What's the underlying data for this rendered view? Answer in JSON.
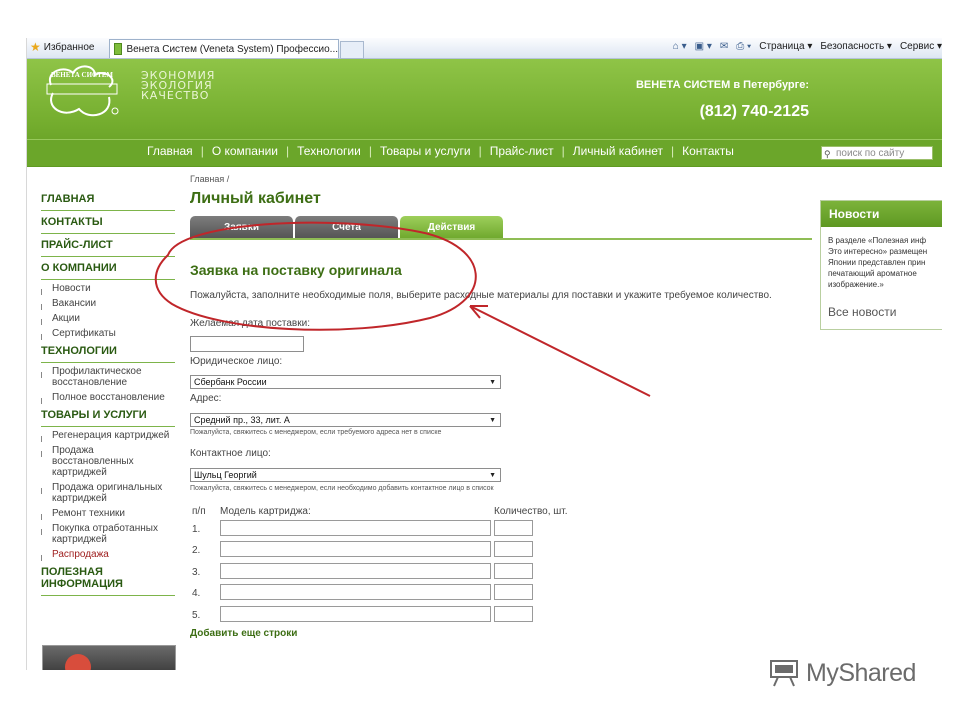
{
  "browser": {
    "favorites_label": "Избранное",
    "tab_title": "Венета Систем (Veneta System) Профессио...",
    "tools": [
      "Страница ▾",
      "Безопасность ▾",
      "Сервис ▾"
    ]
  },
  "header": {
    "logo_text": "ВЕНЕТА СИСТЕМ",
    "slogan": [
      "Экономия",
      "Экология",
      "Качество"
    ],
    "contact_city": "ВЕНЕТА СИСТЕМ в Петербурге:",
    "phone": "(812) 740-2125"
  },
  "nav": {
    "items": [
      "Главная",
      "О компании",
      "Технологии",
      "Товары и услуги",
      "Прайс-лист",
      "Личный кабинет",
      "Контакты"
    ],
    "search_placeholder": "поиск по сайту"
  },
  "sidebar": {
    "head_main": "ГЛАВНАЯ",
    "head_contacts": "КОНТАКТЫ",
    "head_price": "ПРАЙС-ЛИСТ",
    "head_company": "О КОМПАНИИ",
    "company_items": [
      "Новости",
      "Вакансии",
      "Акции",
      "Сертификаты"
    ],
    "head_tech": "ТЕХНОЛОГИИ",
    "tech_items": [
      "Профилактическое восстановление",
      "Полное восстановление"
    ],
    "head_goods": "ТОВАРЫ И УСЛУГИ",
    "goods_items": [
      "Регенерация картриджей",
      "Продажа восстановленных картриджей",
      "Продажа оригинальных картриджей",
      "Ремонт техники",
      "Покупка отработанных картриджей",
      "Распродажа"
    ],
    "head_info": "ПОЛЕЗНАЯ ИНФОРМАЦИЯ"
  },
  "main": {
    "breadcrumb": "Главная /",
    "title": "Личный кабинет",
    "tabs": [
      "Заявки",
      "Счета",
      "Действия"
    ],
    "form_title": "Заявка на поставку оригинала",
    "form_intro": "Пожалуйста, заполните необходимые поля, выберите расходные материалы для поставки и укажите требуемое количество.",
    "date_label": "Желаемая дата поставки:",
    "date_value": "",
    "entity_label": "Юридическое лицо:",
    "entity_value": "Сбербанк России",
    "address_label": "Адрес:",
    "address_value": "Средний пр., 33, лит. А",
    "address_hint": "Пожалуйста, свяжитесь с менеджером, если требуемого адреса нет в списке",
    "contact_label": "Контактное лицо:",
    "contact_value": "Шульц Георгий",
    "contact_hint": "Пожалуйста, свяжитесь с менеджером, если необходимо добавить контактное лицо в список",
    "col_n": "п/п",
    "col_model": "Модель картриджа:",
    "col_qty": "Количество, шт.",
    "rows": [
      "1.",
      "2.",
      "3.",
      "4.",
      "5."
    ],
    "add_rows": "Добавить еще строки"
  },
  "news": {
    "title": "Новости",
    "lines": [
      "В разделе «Полезная инф",
      "Это интересно» размещен",
      "Японии представлен прин",
      "печатающий ароматное",
      "изображение.»"
    ],
    "all_link": "Все новости"
  },
  "watermark": "MyShared",
  "colors": {
    "brand_green": "#74ad2e",
    "nav_green": "#6ba62a",
    "title_green": "#3d6e14",
    "annotation_red": "#c0262a"
  }
}
